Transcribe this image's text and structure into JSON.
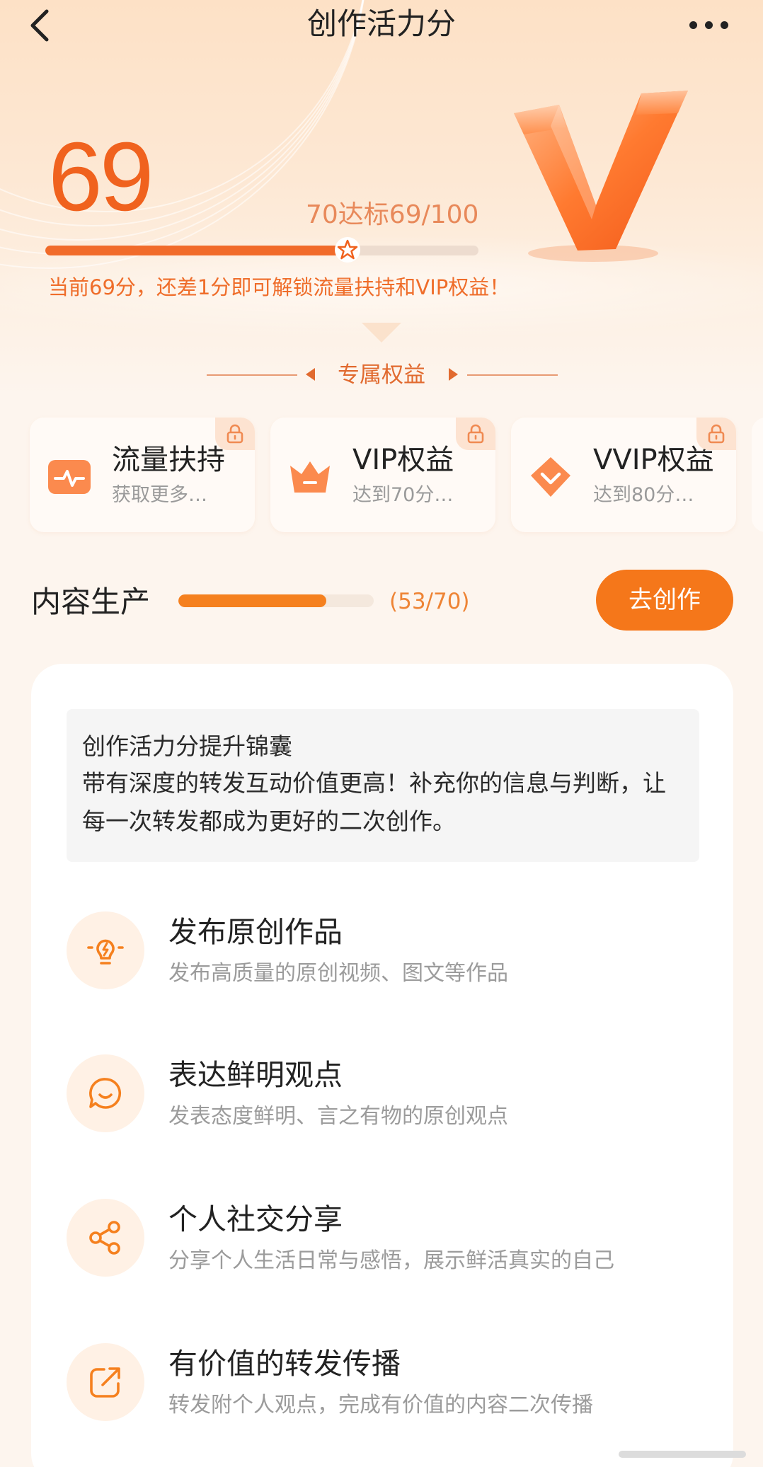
{
  "nav": {
    "title": "创作活力分"
  },
  "score": {
    "value": "69",
    "target_text": "70达标69/100",
    "progress_fraction": 0.69,
    "hint": "当前69分，还差1分即可解锁流量扶持和VIP权益！"
  },
  "benefits": {
    "section_title": "专属权益",
    "items": [
      {
        "name": "流量扶持",
        "desc": "获取更多…",
        "icon": "traffic-icon",
        "locked": true
      },
      {
        "name": "VIP权益",
        "desc": "达到70分…",
        "icon": "crown-icon",
        "locked": true
      },
      {
        "name": "VVIP权益",
        "desc": "达到80分…",
        "icon": "diamond-icon",
        "locked": true
      }
    ]
  },
  "production": {
    "label": "内容生产",
    "current": 53,
    "total": 70,
    "count_text": "(53/70)",
    "button_label": "去创作"
  },
  "tips": {
    "title": "创作活力分提升锦囊",
    "body": "带有深度的转发互动价值更高！补充你的信息与判断，让每一次转发都成为更好的二次创作。"
  },
  "tasks": [
    {
      "title": "发布原创作品",
      "desc": "发布高质量的原创视频、图文等作品",
      "icon": "lightbulb-icon"
    },
    {
      "title": "表达鲜明观点",
      "desc": "发表态度鲜明、言之有物的原创观点",
      "icon": "chat-smile-icon"
    },
    {
      "title": "个人社交分享",
      "desc": "分享个人生活日常与感悟，展示鲜活真实的自己",
      "icon": "share-icon"
    },
    {
      "title": "有价值的转发传播",
      "desc": "转发附个人观点，完成有价值的内容二次传播",
      "icon": "repost-icon"
    }
  ],
  "colors": {
    "accent": "#f16b2a",
    "button": "#f5771a",
    "score": "#f0621e"
  }
}
